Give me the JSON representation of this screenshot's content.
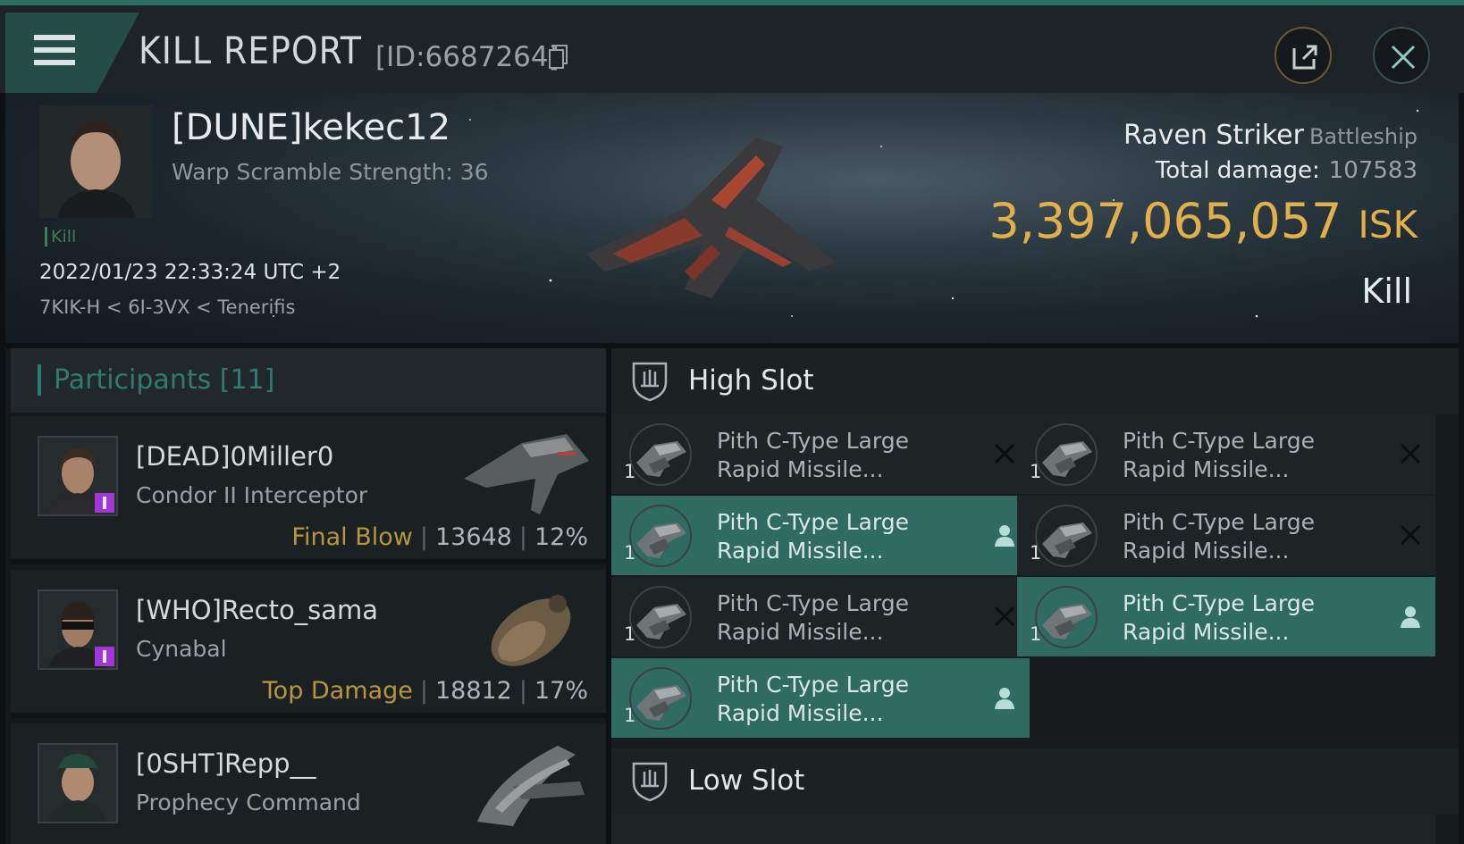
{
  "header": {
    "title": "KILL REPORT",
    "report_id": "[ID:6687264]"
  },
  "victim": {
    "name": "[DUNE]kekec12",
    "sub": "Warp Scramble Strength: 36",
    "tag": "Kill",
    "date": "2022/01/23 22:33:24 UTC +2",
    "location": "7KIK-H < 6I-3VX < Tenerifis",
    "ship_name": "Raven Striker",
    "ship_class": "Battleship",
    "damage_label": "Total damage:",
    "damage_value": "107583",
    "isk_value": "3,397,065,057",
    "isk_unit": "ISK",
    "result": "Kill"
  },
  "participants": {
    "title": "Participants [11]",
    "rows": [
      {
        "name": "[DEAD]0Miller0",
        "ship": "Condor II Interceptor",
        "tag": "Final Blow",
        "damage": "13648",
        "percent": "12%"
      },
      {
        "name": "[WHO]Recto_sama",
        "ship": "Cynabal",
        "tag": "Top Damage",
        "damage": "18812",
        "percent": "17%"
      },
      {
        "name": "[0SHT]Repp__",
        "ship": "Prophecy Command",
        "tag": "",
        "damage": "",
        "percent": ""
      }
    ]
  },
  "fitting": {
    "high_slot_title": "High Slot",
    "low_slot_title": "Low Slot",
    "items": [
      {
        "qty": "1",
        "line1": "Pith C-Type Large",
        "line2": "Rapid Missile...",
        "status": "destroyed"
      },
      {
        "qty": "1",
        "line1": "Pith C-Type Large",
        "line2": "Rapid Missile...",
        "status": "destroyed"
      },
      {
        "qty": "1",
        "line1": "Pith C-Type Large",
        "line2": "Rapid Missile...",
        "status": "dropped"
      },
      {
        "qty": "1",
        "line1": "Pith C-Type Large",
        "line2": "Rapid Missile...",
        "status": "destroyed"
      },
      {
        "qty": "1",
        "line1": "Pith C-Type Large",
        "line2": "Rapid Missile...",
        "status": "destroyed"
      },
      {
        "qty": "1",
        "line1": "Pith C-Type Large",
        "line2": "Rapid Missile...",
        "status": "dropped"
      },
      {
        "qty": "1",
        "line1": "Pith C-Type Large",
        "line2": "Rapid Missile...",
        "status": "dropped"
      }
    ]
  },
  "colors": {
    "accent_teal": "#2f6b62",
    "isk_gold": "#e2b04b",
    "tag_gold": "#b8953f",
    "badge_purple": "#a038d8"
  },
  "icons": [
    "menu-icon",
    "copy-icon",
    "share-icon",
    "close-icon",
    "slot-icon",
    "destroyed-x-icon",
    "dropped-person-icon"
  ]
}
